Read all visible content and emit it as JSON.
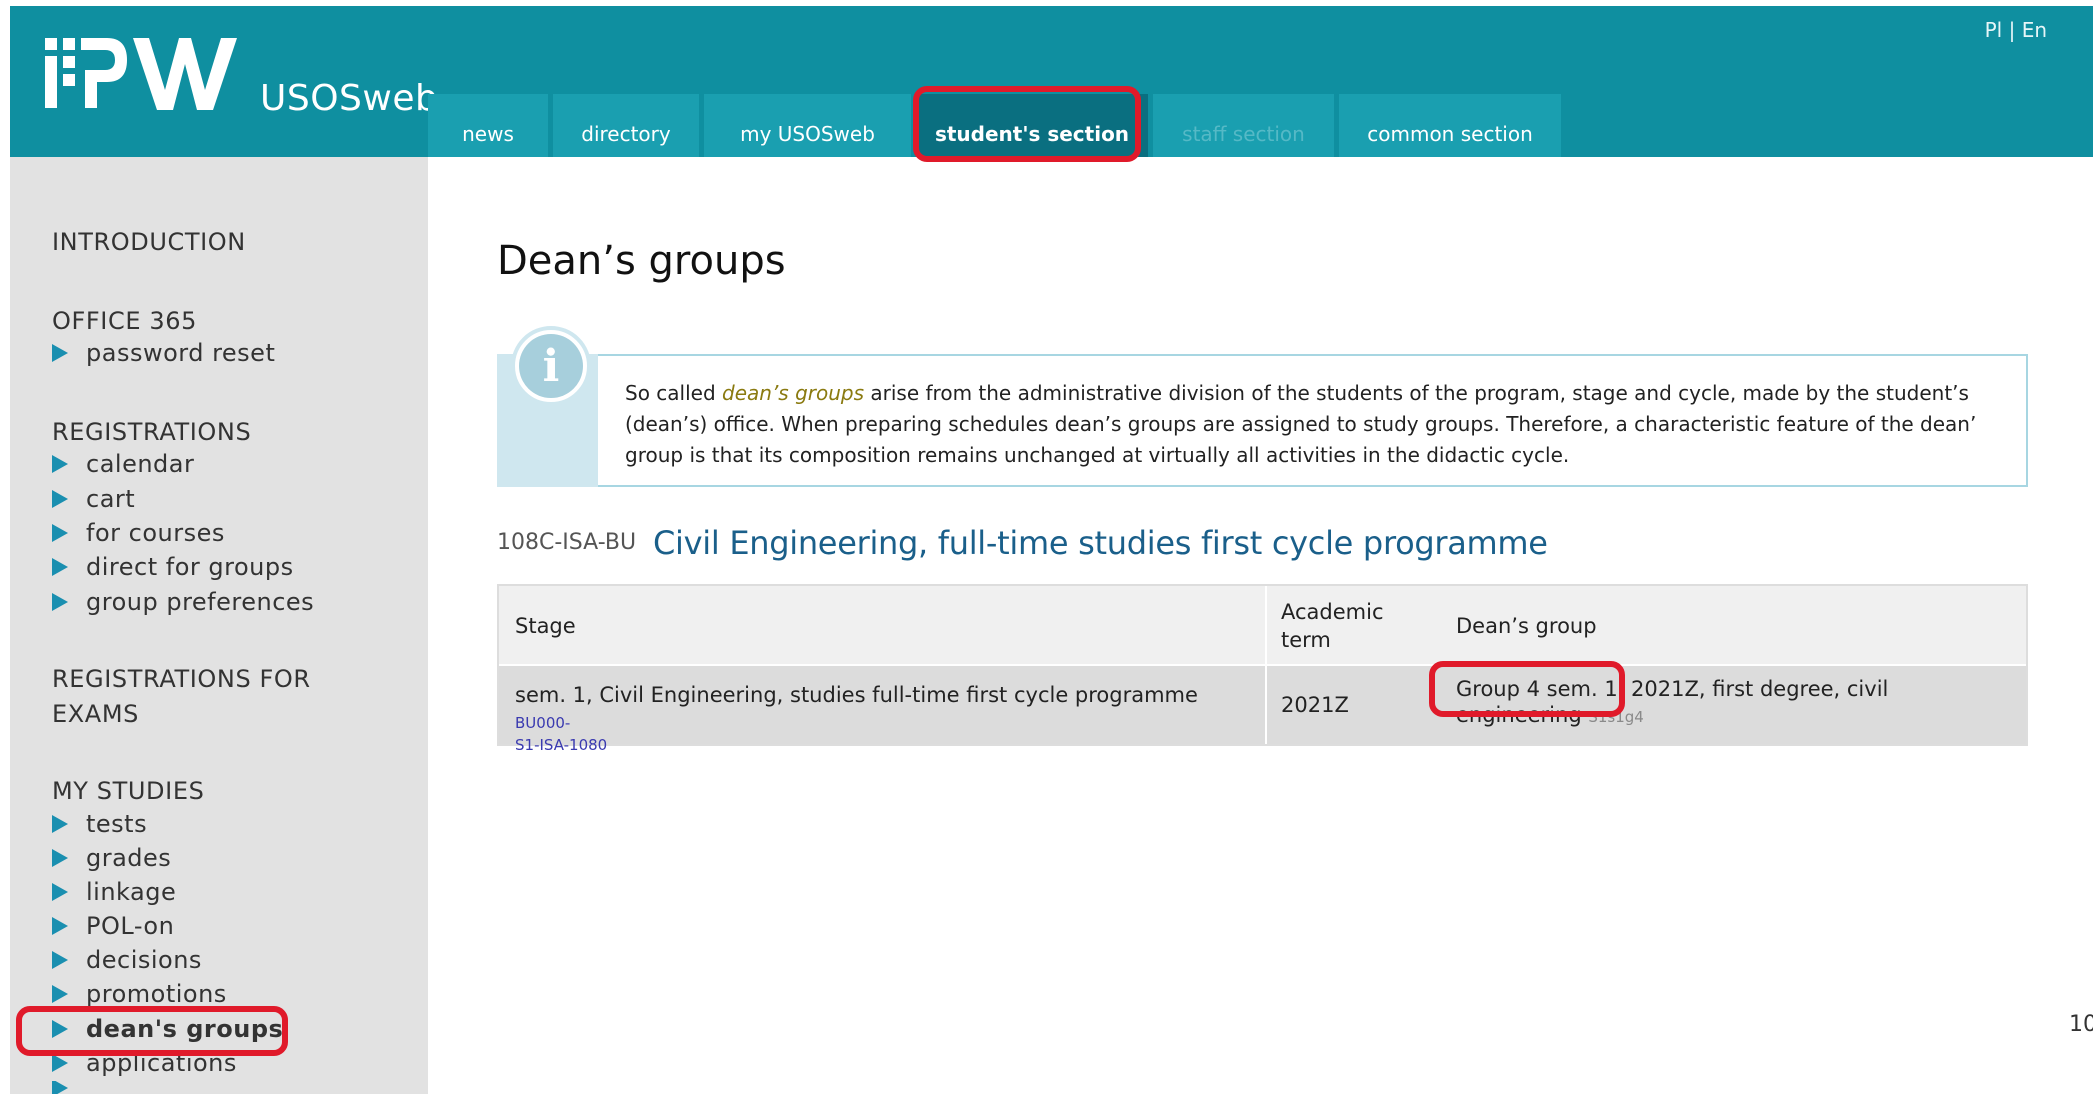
{
  "header": {
    "logo_text": "USOSweb",
    "language": {
      "pl": "Pl",
      "separator": " | ",
      "en": "En"
    },
    "tabs": [
      {
        "label": "news"
      },
      {
        "label": "directory"
      },
      {
        "label": "my USOSweb"
      },
      {
        "label": "student's section"
      },
      {
        "label": "staff section"
      },
      {
        "label": "common section"
      }
    ]
  },
  "sidebar": {
    "introduction": "INTRODUCTION",
    "office365": {
      "title": "OFFICE 365",
      "items": [
        "password reset"
      ]
    },
    "registrations": {
      "title": "REGISTRATIONS",
      "items": [
        "calendar",
        "cart",
        "for courses",
        "direct for groups",
        "group preferences"
      ]
    },
    "registrations_exams": {
      "title_line1": "REGISTRATIONS FOR",
      "title_line2": "EXAMS"
    },
    "my_studies": {
      "title": "MY STUDIES",
      "items": [
        "tests",
        "grades",
        "linkage",
        "POL-on",
        "decisions",
        "promotions",
        "dean's groups",
        "applications"
      ]
    }
  },
  "main": {
    "title": "Dean’s groups",
    "info": {
      "before": "So called ",
      "term": "dean’s groups",
      "after": " arise from the administrative division of the students of the program, stage and cycle, made by the student’s (dean’s) office. When preparing schedules dean’s groups are assigned to study groups. Therefore, a characteristic feature of the dean’ group is that its composition remains unchanged at virtually all activities in the didactic cycle."
    },
    "programme": {
      "code": "108C-ISA-BU",
      "title": "Civil Engineering, full-time studies first cycle programme"
    },
    "table": {
      "headers": {
        "stage": "Stage",
        "term_line1": "Academic",
        "term_line2": "term",
        "group": "Dean’s group"
      },
      "rows": [
        {
          "stage": "sem. 1, Civil Engineering, studies full-time first cycle programme ",
          "stage_code_1": "BU000-",
          "stage_code_2": "S1-ISA-1080",
          "term": "2021Z",
          "group_name": "Group 4 sem. 1",
          "group_desc_1": "2021Z, first degree, civil",
          "group_desc_2": "engineering ",
          "group_code": "S1s1g4"
        }
      ]
    }
  },
  "page_number": "10",
  "colors": {
    "header": "#0f8fa0",
    "tab": "#1a9fb0",
    "tab_active": "#0a6f80",
    "sidebar": "#e2e2e2",
    "highlight": "#e01a2a",
    "link": "#1a5f8a"
  }
}
